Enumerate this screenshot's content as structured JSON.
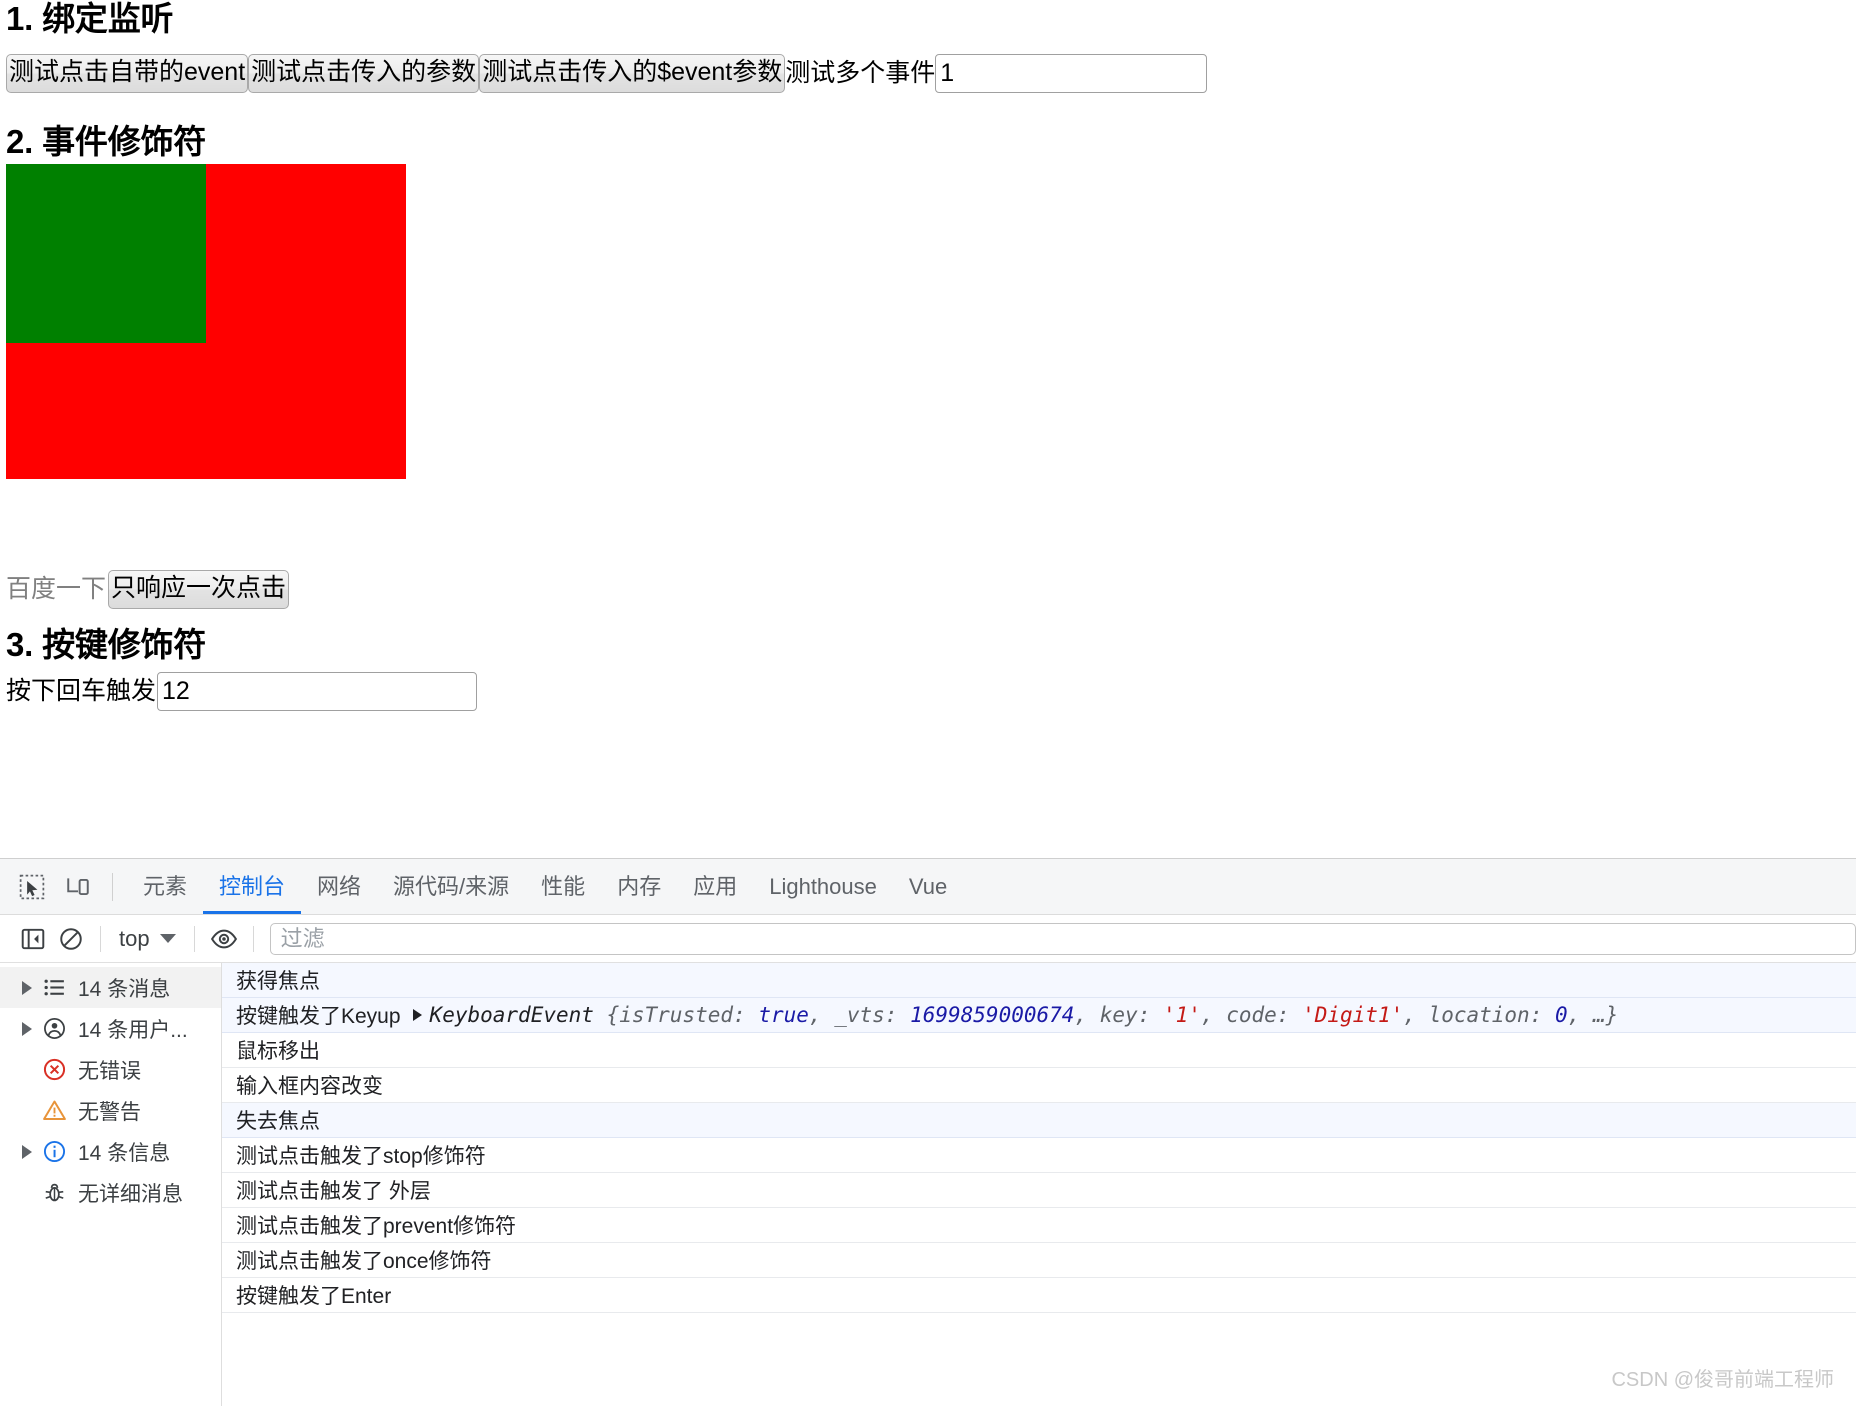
{
  "page": {
    "section1": {
      "title": "1. 绑定监听",
      "buttons": [
        {
          "label": "测试点击自带的event"
        },
        {
          "label": "测试点击传入的参数"
        },
        {
          "label": "测试点击传入的$event参数"
        }
      ],
      "multi_event_label": "测试多个事件",
      "multi_event_value": "1",
      "multi_event_placeholder": ""
    },
    "section2": {
      "title": "2. 事件修饰符",
      "outer_box_color": "#ff0000",
      "inner_box_color": "#008000",
      "link_label": "百度一下",
      "link_color": "#808080",
      "once_button_label": "只响应一次点击"
    },
    "section3": {
      "title": "3. 按键修饰符",
      "enter_label": "按下回车触发",
      "enter_value": "12",
      "enter_placeholder": ""
    }
  },
  "devtools": {
    "accent_color": "#1a73e8",
    "tabs": [
      {
        "label": "元素",
        "active": false
      },
      {
        "label": "控制台",
        "active": true
      },
      {
        "label": "网络",
        "active": false
      },
      {
        "label": "源代码/来源",
        "active": false
      },
      {
        "label": "性能",
        "active": false
      },
      {
        "label": "内存",
        "active": false
      },
      {
        "label": "应用",
        "active": false
      },
      {
        "label": "Lighthouse",
        "active": false
      },
      {
        "label": "Vue",
        "active": false
      }
    ],
    "console_toolbar": {
      "context_label": "top",
      "filter_placeholder": "过滤",
      "filter_value": ""
    },
    "sidebar": [
      {
        "label": "14 条消息",
        "icon": "list-icon",
        "arrow": true,
        "selected": true
      },
      {
        "label": "14 条用户...",
        "icon": "user-icon",
        "arrow": true,
        "selected": false
      },
      {
        "label": "无错误",
        "icon": "error-icon",
        "arrow": false,
        "selected": false
      },
      {
        "label": "无警告",
        "icon": "warning-icon",
        "arrow": false,
        "selected": false
      },
      {
        "label": "14 条信息",
        "icon": "info-icon",
        "arrow": true,
        "selected": false
      },
      {
        "label": "无详细消息",
        "icon": "bug-icon",
        "arrow": false,
        "selected": false
      }
    ],
    "log": [
      {
        "text": "获得焦点",
        "type": "plain"
      },
      {
        "type": "event",
        "prefix": "按键触发了Keyup",
        "class_name": "KeyboardEvent",
        "open_brace": "{",
        "fields": [
          {
            "key": "isTrusted",
            "value": "true",
            "kind": "bool"
          },
          {
            "key": "_vts",
            "value": "1699859000674",
            "kind": "num"
          },
          {
            "key": "key",
            "value": "'1'",
            "kind": "str"
          },
          {
            "key": "code",
            "value": "'Digit1'",
            "kind": "str"
          },
          {
            "key": "location",
            "value": "0",
            "kind": "num"
          }
        ],
        "ellipsis": "…",
        "close_brace": "}"
      },
      {
        "text": "鼠标移出",
        "type": "plain"
      },
      {
        "text": "输入框内容改变",
        "type": "plain"
      },
      {
        "text": "失去焦点",
        "type": "plain"
      },
      {
        "text": "测试点击触发了stop修饰符",
        "type": "plain"
      },
      {
        "text": "测试点击触发了 外层",
        "type": "plain"
      },
      {
        "text": "测试点击触发了prevent修饰符",
        "type": "plain"
      },
      {
        "text": "测试点击触发了once修饰符",
        "type": "plain"
      },
      {
        "text": "按键触发了Enter",
        "type": "plain"
      }
    ]
  },
  "watermark": "CSDN @俊哥前端工程师"
}
